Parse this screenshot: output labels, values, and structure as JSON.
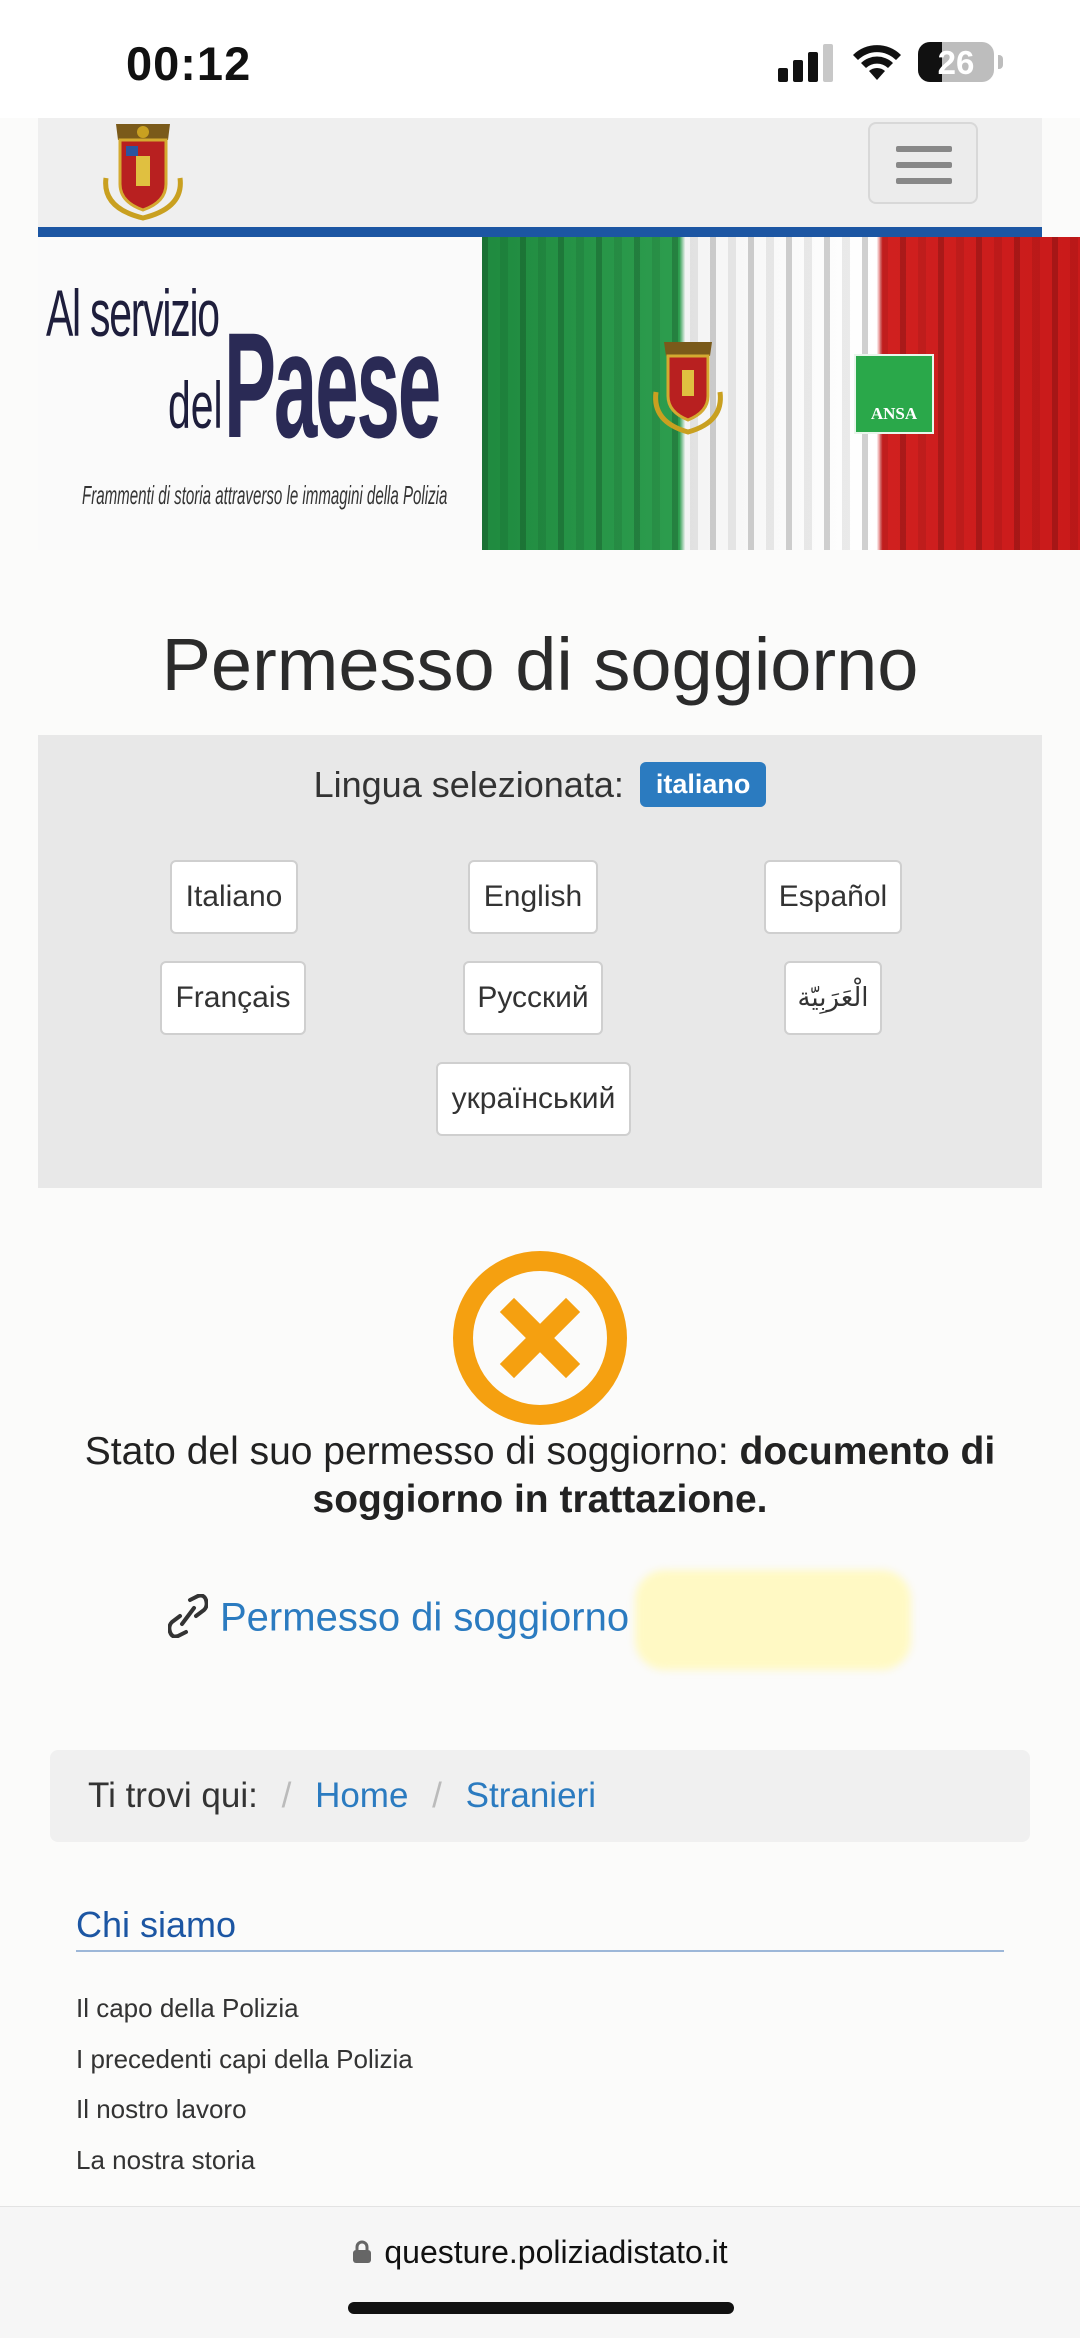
{
  "status_bar": {
    "time": "00:12",
    "battery": "26"
  },
  "banner": {
    "line1": "Al servizio",
    "line2": "del",
    "line3": "Paese",
    "subtitle": "Frammenti di storia attraverso le immagini della Polizia",
    "ansa": "ANSA"
  },
  "page_title": "Permesso di soggiorno",
  "language": {
    "label": "Lingua selezionata:",
    "selected": "italiano",
    "options": [
      "Italiano",
      "English",
      "Español",
      "Français",
      "Русский",
      "الْعَرَبِيّة",
      "український"
    ]
  },
  "status": {
    "prefix": "Stato del suo permesso di soggiorno:",
    "value": "documento di soggiorno in trattazione.",
    "link_text": "Permesso di soggiorno",
    "icon_color": "#f5a010"
  },
  "breadcrumb": {
    "label": "Ti trovi qui:",
    "items": [
      "Home",
      "Stranieri"
    ]
  },
  "chi_siamo": {
    "heading": "Chi siamo",
    "items": [
      "Il capo della Polizia",
      "I precedenti capi della Polizia",
      "Il nostro lavoro",
      "La nostra storia"
    ]
  },
  "url_bar": {
    "url": "questure.poliziadistato.it"
  }
}
